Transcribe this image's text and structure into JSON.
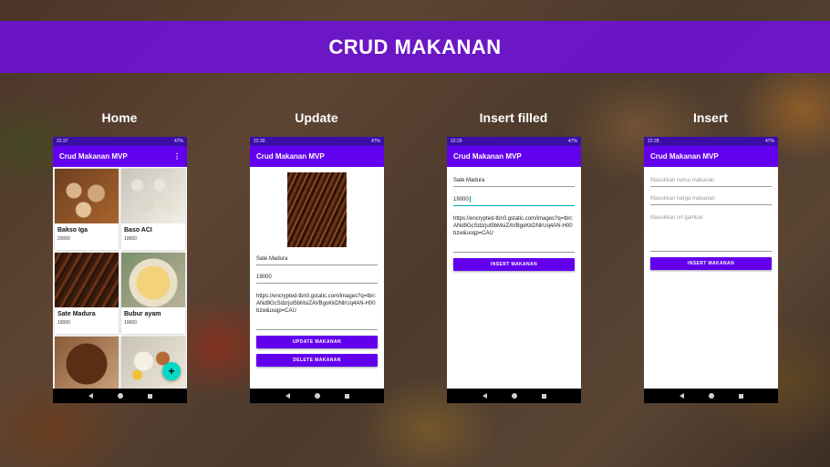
{
  "banner": {
    "title": "CRUD MAKANAN"
  },
  "columns": {
    "home": "Home",
    "update": "Update",
    "insert_filled": "Insert filled",
    "insert": "Insert"
  },
  "app": {
    "title": "Crud Makanan MVP"
  },
  "status_times": {
    "home": "22:37",
    "update": "22:30",
    "insert_filled": "22:29",
    "insert": "22:28"
  },
  "status_battery": "47%",
  "home": {
    "menu_icon": "more-vert-icon",
    "items": [
      {
        "name": "Bakso Iga",
        "price": "20000"
      },
      {
        "name": "Baso ACI",
        "price": "10000"
      },
      {
        "name": "Sate Madura",
        "price": "19000"
      },
      {
        "name": "Bubur ayam",
        "price": "10000"
      },
      {
        "name": "",
        "price": ""
      },
      {
        "name": "",
        "price": ""
      }
    ],
    "fab_icon": "add-icon",
    "fab_label": "+"
  },
  "update": {
    "name": "Sate Madura",
    "price": "19000",
    "url": "https://encrypted-tbn0.gstatic.com/images?q=tbn:ANd9GcSdzrjut5bMsiZAVBgoKkDNlrUq4AN-H00bzw&usqp=CAU",
    "update_button": "UPDATE MAKANAN",
    "delete_button": "DELETE MAKANAN"
  },
  "insert_filled": {
    "name": "Sate Madura",
    "price": "19000",
    "url": "https://encrypted-tbn0.gstatic.com/images?q=tbn:ANd9GcSdzrjut5bMsiZAVBgoKkDNlrUq4AN-H00bzw&usqp=CAU",
    "insert_button": "INSERT MAKANAN"
  },
  "insert": {
    "name_placeholder": "Masukkan nama makanan",
    "price_placeholder": "Masukkan harga makanan",
    "url_placeholder": "Masukkan url gambar",
    "insert_button": "INSERT MAKANAN"
  },
  "colors": {
    "banner": "#6e14d2",
    "app_bar": "#6200ee",
    "status_bar": "#3a0fa8",
    "fab": "#03dac5",
    "button": "#6200ee"
  }
}
